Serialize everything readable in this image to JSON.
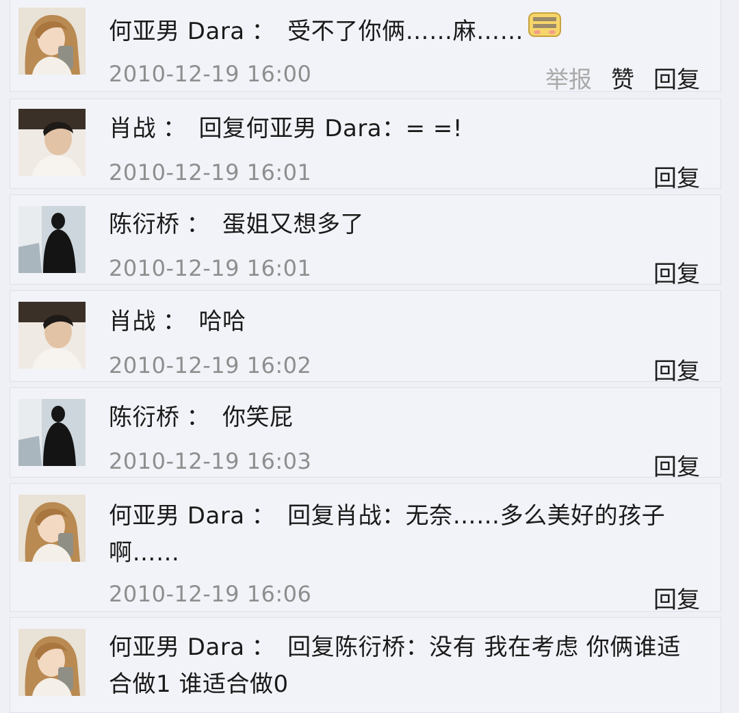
{
  "comments": [
    {
      "author": "何亚男 Dara",
      "separator": "：",
      "text": "受不了你俩……麻……",
      "time": "2010-12-19 16:00",
      "actions": {
        "report": "举报",
        "like": "赞",
        "reply": "回复"
      },
      "avatar": "woman-photo",
      "emoji": "shy-face-emoji"
    },
    {
      "author": "肖战",
      "separator": "：",
      "text": "回复何亚男 Dara：= =!",
      "time": "2010-12-19 16:01",
      "actions": {
        "reply": "回复"
      },
      "avatar": "man-photo"
    },
    {
      "author": "陈衍桥",
      "separator": "：",
      "text": "蛋姐又想多了",
      "time": "2010-12-19 16:01",
      "actions": {
        "reply": "回复"
      },
      "avatar": "silhouette-photo"
    },
    {
      "author": "肖战",
      "separator": "：",
      "text": "哈哈",
      "time": "2010-12-19 16:02",
      "actions": {
        "reply": "回复"
      },
      "avatar": "man-photo"
    },
    {
      "author": "陈衍桥",
      "separator": "：",
      "text": "你笑屁",
      "time": "2010-12-19 16:03",
      "actions": {
        "reply": "回复"
      },
      "avatar": "silhouette-photo"
    },
    {
      "author": "何亚男 Dara",
      "separator": "：",
      "text": "回复肖战：无奈……多么美好的孩子啊……",
      "time": "2010-12-19 16:06",
      "actions": {
        "reply": "回复"
      },
      "avatar": "woman-photo"
    },
    {
      "author": "何亚男 Dara",
      "separator": "：",
      "text": "回复陈衍桥：没有 我在考虑 你俩谁适合做1 谁适合做0",
      "avatar": "woman-photo"
    }
  ],
  "colors": {
    "background": "#eef0f6",
    "card": "#f2f3f8",
    "time": "#8e8e8e",
    "report": "#aaaaaa"
  }
}
